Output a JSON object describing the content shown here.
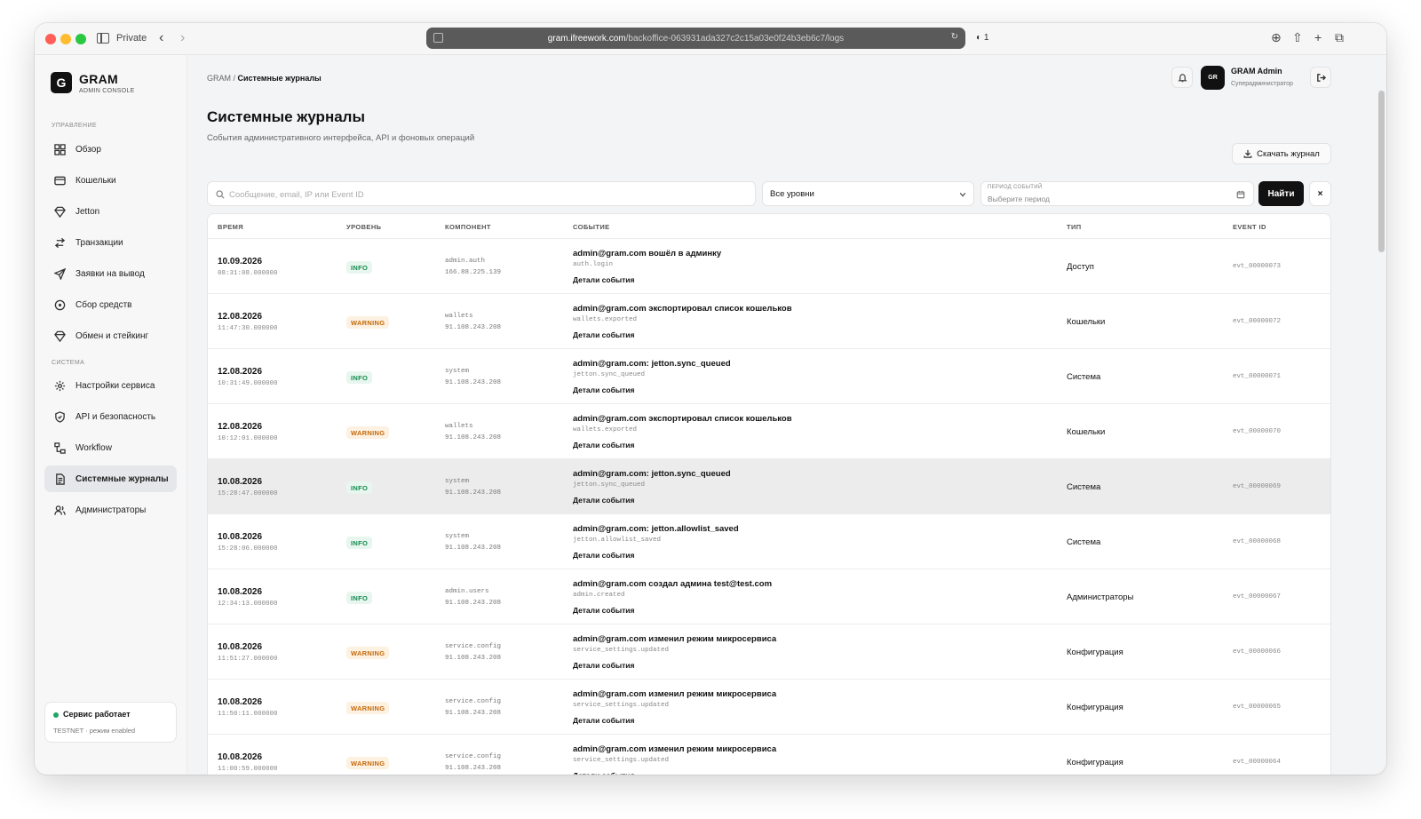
{
  "browser": {
    "private_label": "Private",
    "url_host": "gram.ifreework.com",
    "url_path": "/backoffice-063931ada327c2c15a03e0f24b3eb6c7/logs",
    "shield_count": "1"
  },
  "sidebar": {
    "logo_letter": "G",
    "brand": "GRAM",
    "brand_sub": "ADMIN CONSOLE",
    "section_manage": "УПРАВЛЕНИЕ",
    "section_system": "СИСТЕМА",
    "items": [
      {
        "label": "Обзор",
        "icon": "grid-icon"
      },
      {
        "label": "Кошельки",
        "icon": "wallet-icon"
      },
      {
        "label": "Jetton",
        "icon": "diamond-icon"
      },
      {
        "label": "Транзакции",
        "icon": "arrows-icon"
      },
      {
        "label": "Заявки на вывод",
        "icon": "send-icon"
      },
      {
        "label": "Сбор средств",
        "icon": "coin-icon"
      },
      {
        "label": "Обмен и стейкинг",
        "icon": "diamond-icon"
      },
      {
        "label": "Настройки сервиса",
        "icon": "gear-icon"
      },
      {
        "label": "API и безопасность",
        "icon": "shield-icon"
      },
      {
        "label": "Workflow",
        "icon": "workflow-icon"
      },
      {
        "label": "Системные журналы",
        "icon": "document-icon"
      },
      {
        "label": "Администраторы",
        "icon": "users-icon"
      }
    ],
    "status_title": "Сервис работает",
    "status_sub": "TESTNET · режим enabled"
  },
  "header": {
    "breadcrumb_root": "GRAM",
    "breadcrumb_current": "Системные журналы",
    "avatar_initials": "GR",
    "user_name": "GRAM Admin",
    "user_role": "Суперадминистратор"
  },
  "page": {
    "title": "Системные журналы",
    "subtitle": "События административного интерфейса, API и фоновых операций",
    "download_label": "Скачать журнал"
  },
  "filters": {
    "search_placeholder": "Сообщение, email, IP или Event ID",
    "search_value": "",
    "level_value": "Все уровни",
    "period_label": "ПЕРИОД СОБЫТИЙ",
    "period_placeholder": "Выберите период",
    "find_label": "Найти",
    "clear_label": "×"
  },
  "table": {
    "columns": [
      "ВРЕМЯ",
      "УРОВЕНЬ",
      "КОМПОНЕНТ",
      "СОБЫТИЕ",
      "ТИП",
      "EVENT ID"
    ],
    "details_label": "Детали события",
    "rows": [
      {
        "date": "10.09.2026",
        "time": "08:31:08.000000",
        "level": "INFO",
        "component": "admin.auth",
        "ip": "166.88.225.139",
        "event": "admin@gram.com вошёл в админку",
        "code": "auth.login",
        "type": "Доступ",
        "id": "evt_00000073"
      },
      {
        "date": "12.08.2026",
        "time": "11:47:30.000000",
        "level": "WARNING",
        "component": "wallets",
        "ip": "91.108.243.208",
        "event": "admin@gram.com экспортировал список кошельков",
        "code": "wallets.exported",
        "type": "Кошельки",
        "id": "evt_00000072"
      },
      {
        "date": "12.08.2026",
        "time": "10:31:49.000000",
        "level": "INFO",
        "component": "system",
        "ip": "91.108.243.208",
        "event": "admin@gram.com: jetton.sync_queued",
        "code": "jetton.sync_queued",
        "type": "Система",
        "id": "evt_00000071"
      },
      {
        "date": "12.08.2026",
        "time": "10:12:01.000000",
        "level": "WARNING",
        "component": "wallets",
        "ip": "91.108.243.208",
        "event": "admin@gram.com экспортировал список кошельков",
        "code": "wallets.exported",
        "type": "Кошельки",
        "id": "evt_00000070"
      },
      {
        "date": "10.08.2026",
        "time": "15:28:47.000000",
        "level": "INFO",
        "component": "system",
        "ip": "91.108.243.208",
        "event": "admin@gram.com: jetton.sync_queued",
        "code": "jetton.sync_queued",
        "type": "Система",
        "id": "evt_00000069"
      },
      {
        "date": "10.08.2026",
        "time": "15:28:06.000000",
        "level": "INFO",
        "component": "system",
        "ip": "91.108.243.208",
        "event": "admin@gram.com: jetton.allowlist_saved",
        "code": "jetton.allowlist_saved",
        "type": "Система",
        "id": "evt_00000068"
      },
      {
        "date": "10.08.2026",
        "time": "12:34:13.000000",
        "level": "INFO",
        "component": "admin.users",
        "ip": "91.108.243.208",
        "event": "admin@gram.com создал админа test@test.com",
        "code": "admin.created",
        "type": "Администраторы",
        "id": "evt_00000067"
      },
      {
        "date": "10.08.2026",
        "time": "11:51:27.000000",
        "level": "WARNING",
        "component": "service.config",
        "ip": "91.108.243.208",
        "event": "admin@gram.com изменил режим микросервиса",
        "code": "service_settings.updated",
        "type": "Конфигурация",
        "id": "evt_00000066"
      },
      {
        "date": "10.08.2026",
        "time": "11:50:11.000000",
        "level": "WARNING",
        "component": "service.config",
        "ip": "91.108.243.208",
        "event": "admin@gram.com изменил режим микросервиса",
        "code": "service_settings.updated",
        "type": "Конфигурация",
        "id": "evt_00000065"
      },
      {
        "date": "10.08.2026",
        "time": "11:00:59.000000",
        "level": "WARNING",
        "component": "service.config",
        "ip": "91.108.243.208",
        "event": "admin@gram.com изменил режим микросервиса",
        "code": "service_settings.updated",
        "type": "Конфигурация",
        "id": "evt_00000064"
      }
    ]
  }
}
